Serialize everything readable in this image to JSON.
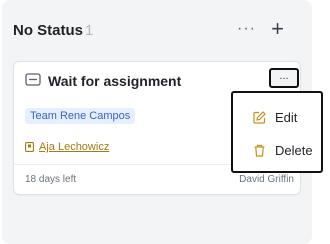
{
  "column": {
    "title": "No Status",
    "count": "1",
    "more_glyph": "···",
    "add_glyph": "+"
  },
  "card": {
    "type_icon": "mail-icon",
    "title": "Wait for assignment",
    "more_glyph": "...",
    "team": "Team Rene Campos",
    "assignee": "Aja Lechowicz",
    "due": "18 days left",
    "owner": "David Griffin"
  },
  "menu": {
    "edit_label": "Edit",
    "delete_label": "Delete",
    "edit_icon": "edit-icon",
    "delete_icon": "trash-icon"
  },
  "colors": {
    "team_tag_text": "#3a63c5",
    "team_tag_bg": "#e6efff",
    "assignee_link": "#a37b12",
    "menu_icon": "#c8901a"
  }
}
